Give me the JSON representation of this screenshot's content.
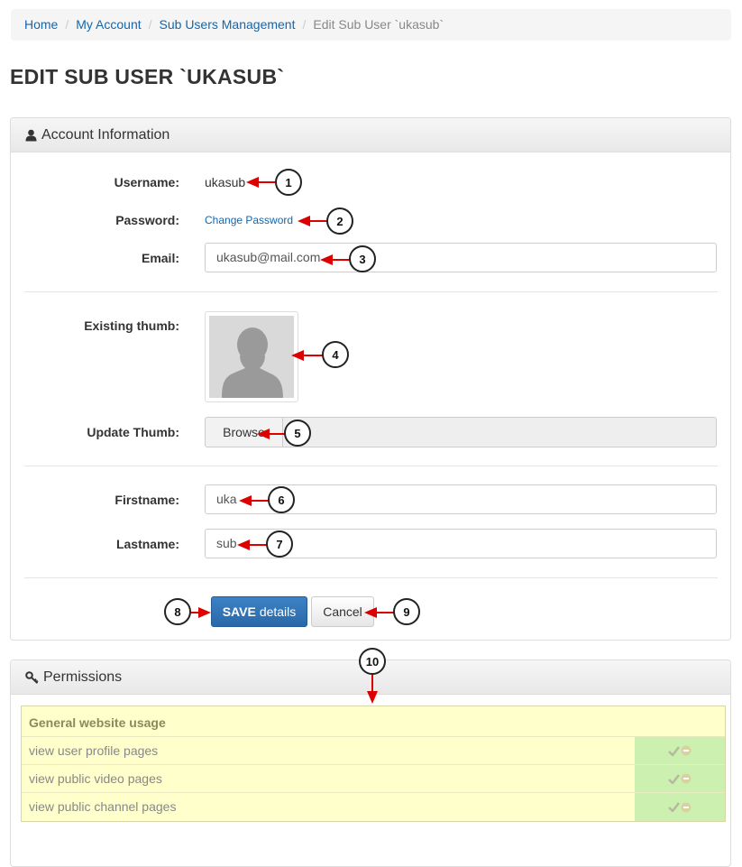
{
  "breadcrumb": {
    "items": [
      "Home",
      "My Account",
      "Sub Users Management"
    ],
    "current": "Edit Sub User `ukasub`"
  },
  "page_title": "EDIT SUB USER `UKASUB`",
  "account_panel": {
    "title": "Account Information",
    "username_label": "Username:",
    "username_value": "ukasub",
    "password_label": "Password:",
    "change_password_link": "Change Password",
    "email_label": "Email:",
    "email_value": "ukasub@mail.com",
    "existing_thumb_label": "Existing thumb:",
    "update_thumb_label": "Update Thumb:",
    "browse_label": "Browse",
    "firstname_label": "Firstname:",
    "firstname_value": "uka",
    "lastname_label": "Lastname:",
    "lastname_value": "sub",
    "save_bold": "SAVE",
    "save_rest": "details",
    "cancel_label": "Cancel"
  },
  "permissions_panel": {
    "title": "Permissions",
    "group_title": "General website usage",
    "rows": [
      {
        "label": "view user profile pages"
      },
      {
        "label": "view public video pages"
      },
      {
        "label": "view public channel pages"
      }
    ]
  },
  "callouts": [
    "1",
    "2",
    "3",
    "4",
    "5",
    "6",
    "7",
    "8",
    "9",
    "10"
  ],
  "colors": {
    "link": "#1466ad",
    "primary_button": "#3071b4",
    "annotation_arrow": "#dd0000",
    "permission_bg": "#ffffcc",
    "permission_allowed": "#ccf0b0"
  },
  "icons": {
    "account_panel": "user-icon",
    "permissions_panel": "key-icon",
    "permission_allow": "check-icon",
    "permission_deny": "minus-circle-icon"
  }
}
